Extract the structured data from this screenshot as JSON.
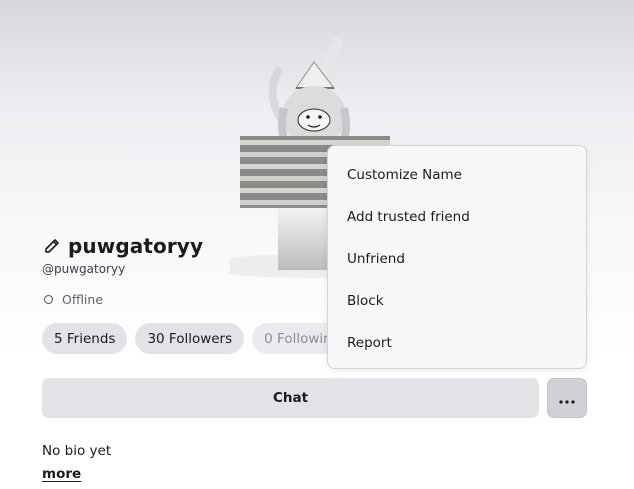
{
  "profile": {
    "display_name": "puwgatoryy",
    "username": "@puwgatoryy",
    "status": "Offline"
  },
  "stats": {
    "friends": "5 Friends",
    "followers": "30 Followers",
    "following": "0 Following"
  },
  "actions": {
    "chat_label": "Chat",
    "more_icon": "ellipsis-icon"
  },
  "bio": {
    "text": "No bio yet",
    "more_label": "more"
  },
  "menu": {
    "items": [
      {
        "label": "Customize Name"
      },
      {
        "label": "Add trusted friend"
      },
      {
        "label": "Unfriend"
      },
      {
        "label": "Block"
      },
      {
        "label": "Report"
      }
    ]
  },
  "icons": {
    "edit": "pencil-icon",
    "status": "offline-status-icon"
  }
}
